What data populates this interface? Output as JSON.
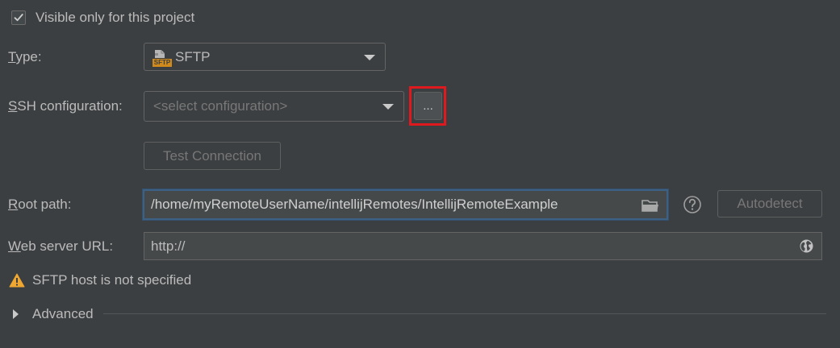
{
  "visible_checkbox": {
    "label": "Visible only for this project",
    "checked": true
  },
  "type_row": {
    "label_mnemonic": "T",
    "label_rest": "ype:",
    "value": "SFTP",
    "icon_text": "SFTP"
  },
  "ssh_row": {
    "label_mnemonic": "S",
    "label_rest": "SH configuration:",
    "placeholder": "<select configuration>",
    "browse_label": "...",
    "highlight_color": "#e0191f"
  },
  "test_connection": {
    "label": "Test Connection"
  },
  "root_path": {
    "label_mnemonic": "R",
    "label_rest": "oot path:",
    "value": "/home/myRemoteUserName/intellijRemotes/IntellijRemoteExample",
    "folder_icon": "folder-icon",
    "help_icon": "help-icon",
    "autodetect_label": "Autodetect"
  },
  "web_server": {
    "label_mnemonic": "W",
    "label_rest": "eb server URL:",
    "value": "http://",
    "globe_icon": "globe-icon"
  },
  "warning": {
    "text": "SFTP host is not specified",
    "icon": "warning-icon",
    "color": "#f0a732"
  },
  "advanced": {
    "label": "Advanced",
    "icon": "triangle-right-icon"
  }
}
